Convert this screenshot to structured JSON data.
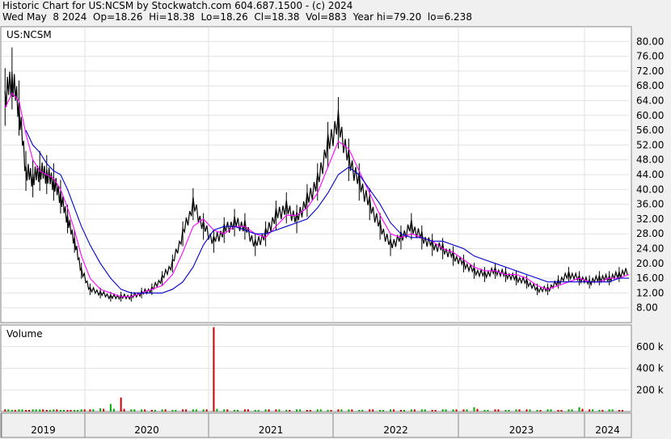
{
  "header": {
    "line1": "Historic Chart for US:NCSM by Stockwatch.com 604.687.1500 - (c) 2024",
    "line2": "Wed May  8 2024  Op=18.26  Hi=18.38  Lo=18.26  Cl=18.38  Vol=883  Year hi=79.20  lo=6.238"
  },
  "price_panel": {
    "label": "US:NCSM"
  },
  "volume_panel": {
    "label": "Volume"
  },
  "chart_data": [
    {
      "type": "line",
      "title": "US:NCSM",
      "ylim": [
        4,
        84
      ],
      "y_ticks": [
        "80.00",
        "76.00",
        "72.00",
        "68.00",
        "64.00",
        "60.00",
        "56.00",
        "52.00",
        "48.00",
        "44.00",
        "40.00",
        "36.00",
        "32.00",
        "28.00",
        "24.00",
        "20.00",
        "16.00",
        "12.00",
        "8.00"
      ],
      "x_ticks": [
        "2019",
        "2020",
        "2021",
        "2022",
        "2023",
        "2024"
      ],
      "x": [
        "2019-01",
        "2019-02",
        "2019-03",
        "2019-04",
        "2019-05",
        "2019-06",
        "2019-07",
        "2019-08",
        "2019-09",
        "2019-10",
        "2019-11",
        "2019-12",
        "2020-01",
        "2020-02",
        "2020-03",
        "2020-04",
        "2020-05",
        "2020-06",
        "2020-07",
        "2020-08",
        "2020-09",
        "2020-10",
        "2020-11",
        "2020-12",
        "2021-01",
        "2021-02",
        "2021-03",
        "2021-04",
        "2021-05",
        "2021-06",
        "2021-07",
        "2021-08",
        "2021-09",
        "2021-10",
        "2021-11",
        "2021-12",
        "2022-01",
        "2022-02",
        "2022-03",
        "2022-04",
        "2022-05",
        "2022-06",
        "2022-07",
        "2022-08",
        "2022-09",
        "2022-10",
        "2022-11",
        "2022-12",
        "2023-01",
        "2023-02",
        "2023-03",
        "2023-04",
        "2023-05",
        "2023-06",
        "2023-07",
        "2023-08",
        "2023-09",
        "2023-10",
        "2023-11",
        "2023-12",
        "2024-01",
        "2024-02",
        "2024-03",
        "2024-04",
        "2024-05"
      ],
      "series": [
        {
          "role": "price",
          "color": "#000000",
          "values": [
            65,
            70,
            62,
            45,
            43,
            45,
            44,
            42,
            38,
            32,
            26,
            18,
            13,
            12,
            11,
            11,
            11,
            12,
            13,
            16,
            20,
            28,
            36,
            30,
            26,
            29,
            31,
            30,
            25,
            28,
            33,
            35,
            32,
            37,
            42,
            52,
            58,
            48,
            42,
            36,
            30,
            25,
            27,
            30,
            27,
            25,
            24,
            22,
            20,
            18,
            17,
            18,
            17,
            16,
            15,
            13,
            13,
            15,
            17,
            16,
            15,
            16,
            16,
            17,
            18
          ]
        },
        {
          "role": "short-moving-average",
          "color": "#ff00ff",
          "values": [
            62,
            66,
            64,
            55,
            48,
            45,
            44,
            43,
            40,
            35,
            29,
            22,
            16,
            13,
            12,
            11,
            11,
            12,
            13,
            14,
            17,
            23,
            30,
            32,
            29,
            28,
            30,
            30,
            28,
            27,
            30,
            33,
            33,
            35,
            39,
            46,
            53,
            51,
            45,
            39,
            33,
            28,
            27,
            28,
            27,
            26,
            24,
            23,
            21,
            19,
            18,
            18,
            17,
            17,
            16,
            14,
            13,
            14,
            15,
            16,
            15,
            15,
            16,
            16,
            17
          ]
        },
        {
          "role": "long-moving-average",
          "color": "#0000cc",
          "values": [
            null,
            null,
            null,
            56,
            52,
            50,
            47,
            45,
            44,
            40,
            35,
            30,
            25,
            20,
            16,
            13,
            12,
            12,
            12,
            12,
            13,
            15,
            19,
            25,
            29,
            30,
            30,
            29,
            28,
            28,
            29,
            30,
            31,
            32,
            35,
            39,
            44,
            46,
            44,
            40,
            36,
            31,
            28,
            27,
            27,
            26,
            26,
            25,
            24,
            22,
            21,
            20,
            19,
            18,
            17,
            16,
            15,
            15,
            15,
            15,
            15,
            15,
            15,
            16,
            16
          ]
        }
      ]
    },
    {
      "type": "bar",
      "title": "Volume",
      "ylim": [
        0,
        800
      ],
      "y_unit": "k",
      "y_ticks": [
        "600 k",
        "400 k",
        "200 k"
      ],
      "x_ticks": [
        "2019",
        "2020",
        "2021",
        "2022",
        "2023",
        "2024"
      ],
      "x": [
        "2019-01",
        "2019-02",
        "2019-03",
        "2019-04",
        "2019-05",
        "2019-06",
        "2019-07",
        "2019-08",
        "2019-09",
        "2019-10",
        "2019-11",
        "2019-12",
        "2020-01",
        "2020-02",
        "2020-03",
        "2020-04",
        "2020-05",
        "2020-06",
        "2020-07",
        "2020-08",
        "2020-09",
        "2020-10",
        "2020-11",
        "2020-12",
        "2021-01",
        "2021-02",
        "2021-03",
        "2021-04",
        "2021-05",
        "2021-06",
        "2021-07",
        "2021-08",
        "2021-09",
        "2021-10",
        "2021-11",
        "2021-12",
        "2022-01",
        "2022-02",
        "2022-03",
        "2022-04",
        "2022-05",
        "2022-06",
        "2022-07",
        "2022-08",
        "2022-09",
        "2022-10",
        "2022-11",
        "2022-12",
        "2023-01",
        "2023-02",
        "2023-03",
        "2023-04",
        "2023-05",
        "2023-06",
        "2023-07",
        "2023-08",
        "2023-09",
        "2023-10",
        "2023-11",
        "2023-12",
        "2024-01",
        "2024-02",
        "2024-03",
        "2024-04",
        "2024-05"
      ],
      "values": [
        20,
        15,
        20,
        15,
        20,
        20,
        15,
        20,
        15,
        15,
        15,
        20,
        20,
        30,
        70,
        130,
        20,
        20,
        15,
        20,
        15,
        20,
        20,
        20,
        780,
        20,
        15,
        20,
        15,
        20,
        20,
        15,
        20,
        15,
        20,
        15,
        20,
        20,
        15,
        20,
        15,
        20,
        15,
        20,
        20,
        15,
        20,
        20,
        20,
        40,
        15,
        20,
        15,
        20,
        20,
        15,
        20,
        15,
        20,
        40,
        20,
        15,
        20,
        15,
        15
      ],
      "up_color": "#00aa00",
      "down_color": "#cc0000"
    }
  ]
}
